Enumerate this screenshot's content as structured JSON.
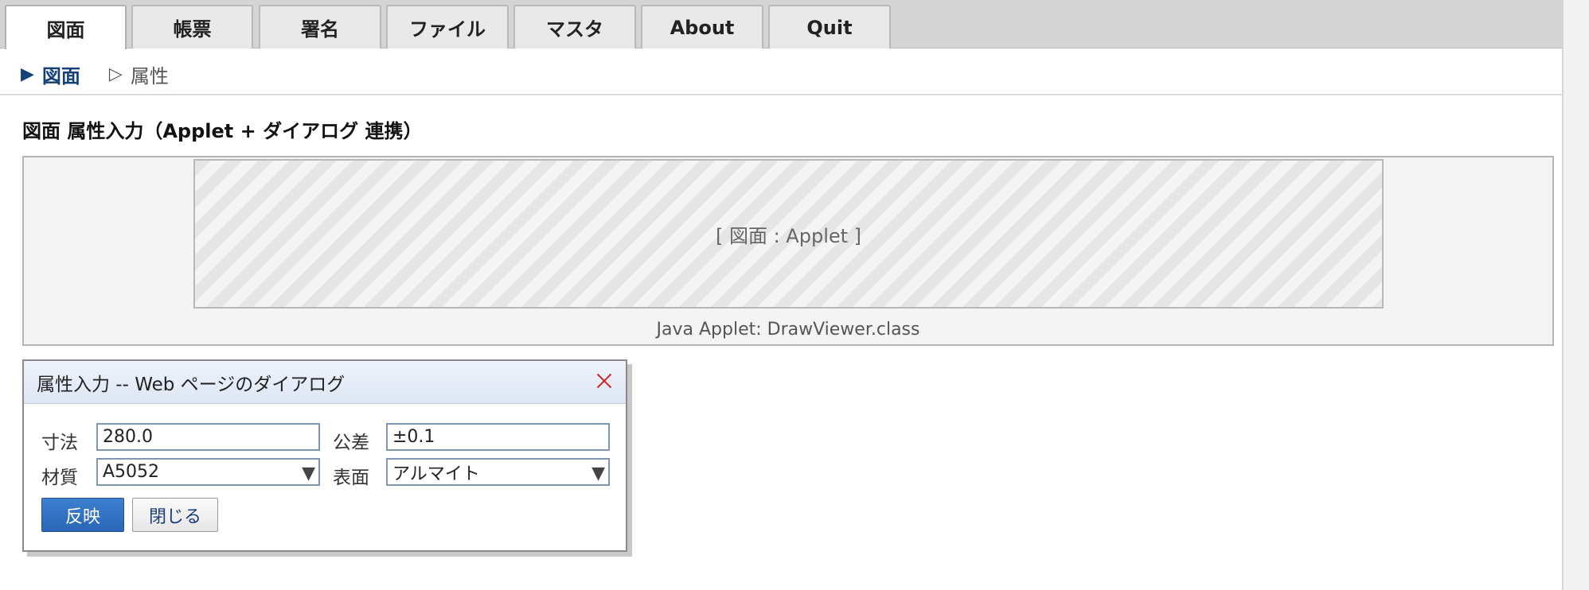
{
  "tabs": [
    {
      "label": "図面",
      "active": true
    },
    {
      "label": "帳票",
      "active": false
    },
    {
      "label": "署名",
      "active": false
    },
    {
      "label": "ファイル",
      "active": false
    },
    {
      "label": "マスタ",
      "active": false
    },
    {
      "label": "About",
      "active": false
    },
    {
      "label": "Quit",
      "active": false
    }
  ],
  "breadcrumb": {
    "current": {
      "icon": "triangle-right-filled-icon",
      "label": "図面"
    },
    "next": {
      "icon": "triangle-right-outline-icon",
      "label": "属性"
    }
  },
  "page": {
    "title": "図面 属性入力（Applet + ダイアログ 連携）"
  },
  "applet": {
    "placeholder_label": "[ 図面 : Applet ]",
    "caption": "Java Applet: DrawViewer.class"
  },
  "dialog": {
    "title": "属性入力 -- Web ページのダイアログ",
    "close_icon": "close-icon",
    "fields": {
      "dimension_label": "寸法",
      "dimension_value": "280.0",
      "tolerance_label": "公差",
      "tolerance_value": "±0.1",
      "material_label": "材質",
      "material_value": "A5052",
      "surface_label": "表面",
      "surface_value": "アルマイト"
    },
    "buttons": {
      "apply": "反映",
      "close": "閉じる"
    }
  },
  "colors": {
    "primary_button": "#2f6fc0",
    "close_x": "#d32222",
    "breadcrumb_active": "#16407a"
  }
}
